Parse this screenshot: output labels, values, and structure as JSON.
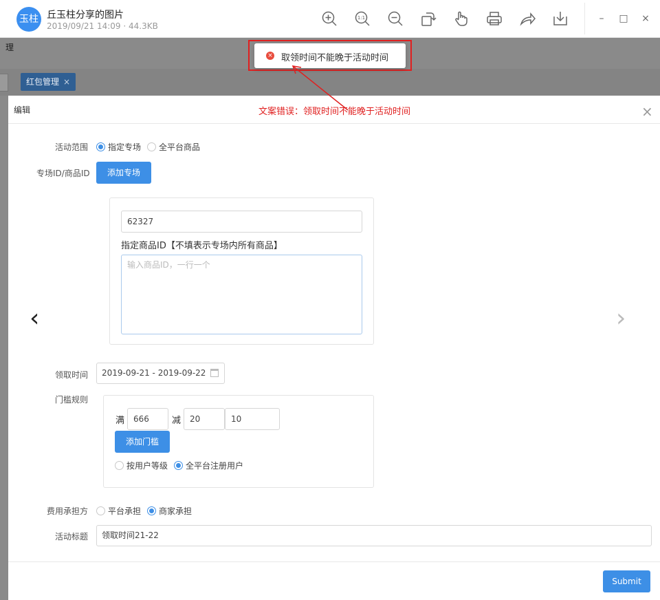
{
  "viewer": {
    "avatar_text": "玉柱",
    "title": "丘玉柱分享的图片",
    "meta": "2019/09/21 14:09 · 44.3KB",
    "toolbar_icons": [
      "zoom-in-icon",
      "actual-size-icon",
      "zoom-out-icon",
      "rotate-icon",
      "hand-icon",
      "print-icon",
      "share-icon",
      "download-icon"
    ],
    "actual_size_label": "1:1",
    "window_controls": [
      "minimize",
      "maximize",
      "close"
    ]
  },
  "background_page": {
    "breadcrumb": "理",
    "tab_label": "红包管理",
    "tab_close": "×"
  },
  "toast": {
    "message": "取领时间不能晚于活动时间",
    "icon": "error-icon",
    "frame_color": "#e02020"
  },
  "annotation": {
    "text": "文案错误：领取时间不能晚于活动时间",
    "color": "#e02020"
  },
  "dialog": {
    "title": "编辑",
    "close": "×",
    "activity_scope": {
      "label": "活动范围",
      "options": [
        {
          "label": "指定专场",
          "selected": true
        },
        {
          "label": "全平台商品",
          "selected": false
        }
      ]
    },
    "venue_ids": {
      "label": "专场ID/商品ID",
      "add_button": "添加专场",
      "venue_id_value": "62327",
      "product_label": "指定商品ID【不填表示专场内所有商品】",
      "product_placeholder": "输入商品ID，一行一个"
    },
    "receive_time": {
      "label": "领取时间",
      "value": "2019-09-21 - 2019-09-22"
    },
    "threshold": {
      "label": "门槛规则",
      "full_label": "满",
      "full_value": "666",
      "minus_label": "减",
      "minus_value_1": "20",
      "minus_value_2": "10",
      "add_button": "添加门槛",
      "options": [
        {
          "label": "按用户等级",
          "selected": false
        },
        {
          "label": "全平台注册用户",
          "selected": true
        }
      ]
    },
    "cost_bearer": {
      "label": "费用承担方",
      "options": [
        {
          "label": "平台承担",
          "selected": false
        },
        {
          "label": "商家承担",
          "selected": true
        }
      ]
    },
    "activity_title": {
      "label": "活动标题",
      "value": "领取时间21-22"
    },
    "submit": "Submit"
  },
  "colors": {
    "primary": "#3d8fe6",
    "overlay": "#8a8a8a",
    "tab_active": "#2f5f93",
    "error": "#e84c3d"
  }
}
